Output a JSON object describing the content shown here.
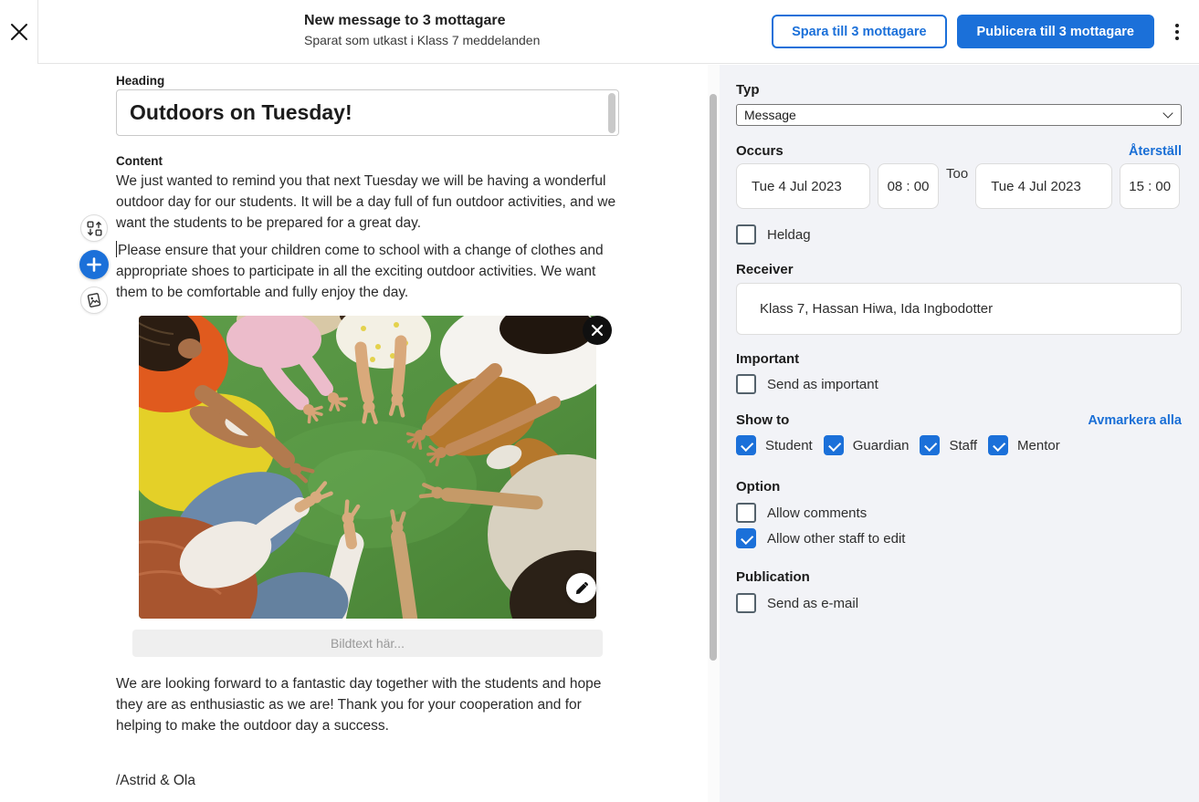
{
  "header": {
    "title": "New message to 3 mottagare",
    "subtitle": "Sparat som utkast i Klass 7 meddelanden",
    "save_button": "Spara till 3 mottagare",
    "publish_button": "Publicera till 3 mottagare"
  },
  "editor": {
    "heading_label": "Heading",
    "heading_value": "Outdoors on Tuesday!",
    "content_label": "Content",
    "paragraphs": [
      "We just wanted to remind you that next Tuesday we will be having a wonderful outdoor day for our students. It will be a day full of fun outdoor activities, and we want the students to be prepared for a great day.",
      "Please ensure that your children come to school with a change of clothes and appropriate shoes to participate in all the exciting outdoor activities. We want them to be comfortable and fully enjoy the day.",
      "We are looking forward to a fantastic day together with the students and hope they are as enthusiastic as we are! Thank you for your cooperation and for helping to make the outdoor day a success."
    ],
    "signature": "/Astrid & Ola",
    "caption_placeholder": "Bildtext här...",
    "image_alt": "Children sitting in a circle on green grass, hands reaching to the center making peace signs",
    "toolbar_icons": [
      "reorder-blocks-icon",
      "add-block-icon",
      "insert-image-icon"
    ],
    "image_icons": [
      "remove-image-icon",
      "edit-image-icon"
    ]
  },
  "sidebar": {
    "type": {
      "label": "Typ",
      "value": "Message"
    },
    "occurs": {
      "label": "Occurs",
      "reset_link": "Återställ",
      "start_date": "Tue 4 Jul 2023",
      "start_time": "08 : 00",
      "to_label": "Too",
      "end_date": "Tue 4 Jul 2023",
      "end_time": "15 : 00",
      "all_day": {
        "label": "Heldag",
        "checked": false
      }
    },
    "receiver": {
      "label": "Receiver",
      "value": "Klass 7, Hassan Hiwa, Ida Ingbodotter"
    },
    "important": {
      "label": "Important",
      "option": {
        "label": "Send as important",
        "checked": false
      }
    },
    "show_to": {
      "label": "Show to",
      "deselect_link": "Avmarkera alla",
      "options": [
        {
          "label": "Student",
          "checked": true
        },
        {
          "label": "Guardian",
          "checked": true
        },
        {
          "label": "Staff",
          "checked": true
        },
        {
          "label": "Mentor",
          "checked": true
        }
      ]
    },
    "option": {
      "label": "Option",
      "options": [
        {
          "label": "Allow comments",
          "checked": false
        },
        {
          "label": "Allow other staff to edit",
          "checked": true
        }
      ]
    },
    "publication": {
      "label": "Publication",
      "options": [
        {
          "label": "Send as e-mail",
          "checked": false
        }
      ]
    }
  },
  "colors": {
    "accent_blue": "#1b70d9",
    "link_blue": "#1a6fd6",
    "sidebar_background": "#f2f3f7",
    "checkbox_border": "#54626c"
  }
}
